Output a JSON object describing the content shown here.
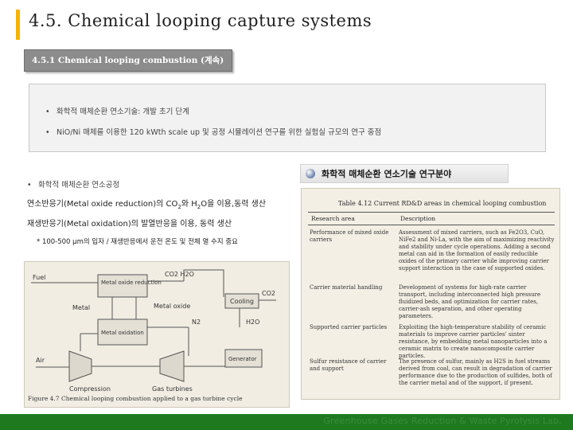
{
  "header": {
    "title": "4.5. Chemical looping capture systems"
  },
  "section": {
    "label": "4.5.1 Chemical looping combustion (계속)"
  },
  "summary": {
    "items": [
      "화학적 매체순환 연소기술: 개발 초기 단계",
      "NiO/Ni 매체를 이용한 120 kWth scale up 및 공정 시뮬레이션 연구를 위한 실험실 규모의 연구 중점"
    ]
  },
  "process": {
    "bullet": "화학적 매체순환 연소공정",
    "fuel_reactor": {
      "prefix": "연소반응기(Metal oxide reduction)의 CO",
      "mid": "와 H",
      "suffix": "O을 이용,동력 생산"
    },
    "air_reactor": "재생반응기(Metal oxidation)의 발열반응을 이용, 동력 생산",
    "note": "* 100-500 μm의 입자 / 재생반응에서 운전 온도 및 전체 열 수지 중요"
  },
  "field_banner": {
    "label": "화학적 매체순환 연소기술 연구분야"
  },
  "table": {
    "caption": "Table 4.12  Current RD&D areas in chemical looping combustion",
    "col_area": "Research area",
    "col_desc": "Description",
    "rows": [
      {
        "area": "Performance of mixed oxide carriers",
        "desc": "Assessment of mixed carriers, such as Fe2O3, CuO, NiFe2 and Ni-La, with the aim of maximizing reactivity and stability under cycle operations. Adding a second metal can aid in the formation of easily reducible oxides of the primary carrier while improving carrier support interaction in the case of supported oxides."
      },
      {
        "area": "Carrier material handling",
        "desc": "Development of systems for high-rate carrier transport, including interconnected high pressure fluidized beds, and optimization for carrier rates, carrier-ash separation, and other operating parameters."
      },
      {
        "area": "Supported carrier particles",
        "desc": "Exploiting the high-temperature stability of ceramic materials to improve carrier particles' sinter resistance, by embedding metal nanoparticles into a ceramic matrix to create nanocomposite carrier particles."
      },
      {
        "area": "Sulfur resistance of carrier and support",
        "desc": "The presence of sulfur, mainly as H2S in fuel streams derived from coal, can result in degradation of carrier performance due to the production of sulfides, both of the carrier metal and of the support, if present."
      }
    ]
  },
  "figure": {
    "labels": {
      "fuel": "Fuel",
      "products": "CO2 H2O",
      "reduction": "Metal oxide reduction",
      "metal": "Metal",
      "metal_oxide": "Metal oxide",
      "co2": "CO2",
      "cooling": "Cooling",
      "oxidation": "Metal oxidation",
      "n2": "N2",
      "h2o": "H2O",
      "air": "Air",
      "generator": "Generator",
      "compression": "Compression",
      "gas_turbines": "Gas turbines"
    },
    "caption": "Figure 4.7  Chemical looping combustion applied to a gas turbine cycle"
  },
  "footer": {
    "text": "Greenhouse Gases Reduction & Waste Pyrolysis Lab."
  },
  "colors": {
    "accent": "#f5b400",
    "tab": "#8c8c8c",
    "footer": "#1f7a1f"
  }
}
